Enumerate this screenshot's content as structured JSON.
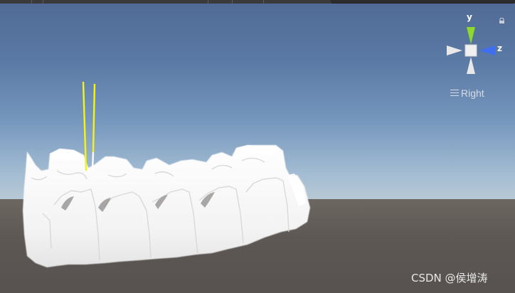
{
  "scene_view": {
    "orientation_label": "Right",
    "gizmo": {
      "y_label": "y",
      "z_label": "z",
      "colors": {
        "y_axis": "#8fd82e",
        "z_axis": "#3d6ff0",
        "neutral": "#e8e8e8",
        "center": "#f0f0f0"
      }
    },
    "icons": {
      "view_menu": "hamburger-menu-icon",
      "lock": "lock-icon"
    },
    "colors": {
      "sky_top": "#4f6a95",
      "horizon": "#b9c9d4",
      "ground": "#5e5854",
      "model": "#f2f2f2",
      "marker_line": "#f4f419"
    }
  },
  "watermark": "CSDN @侯增涛"
}
